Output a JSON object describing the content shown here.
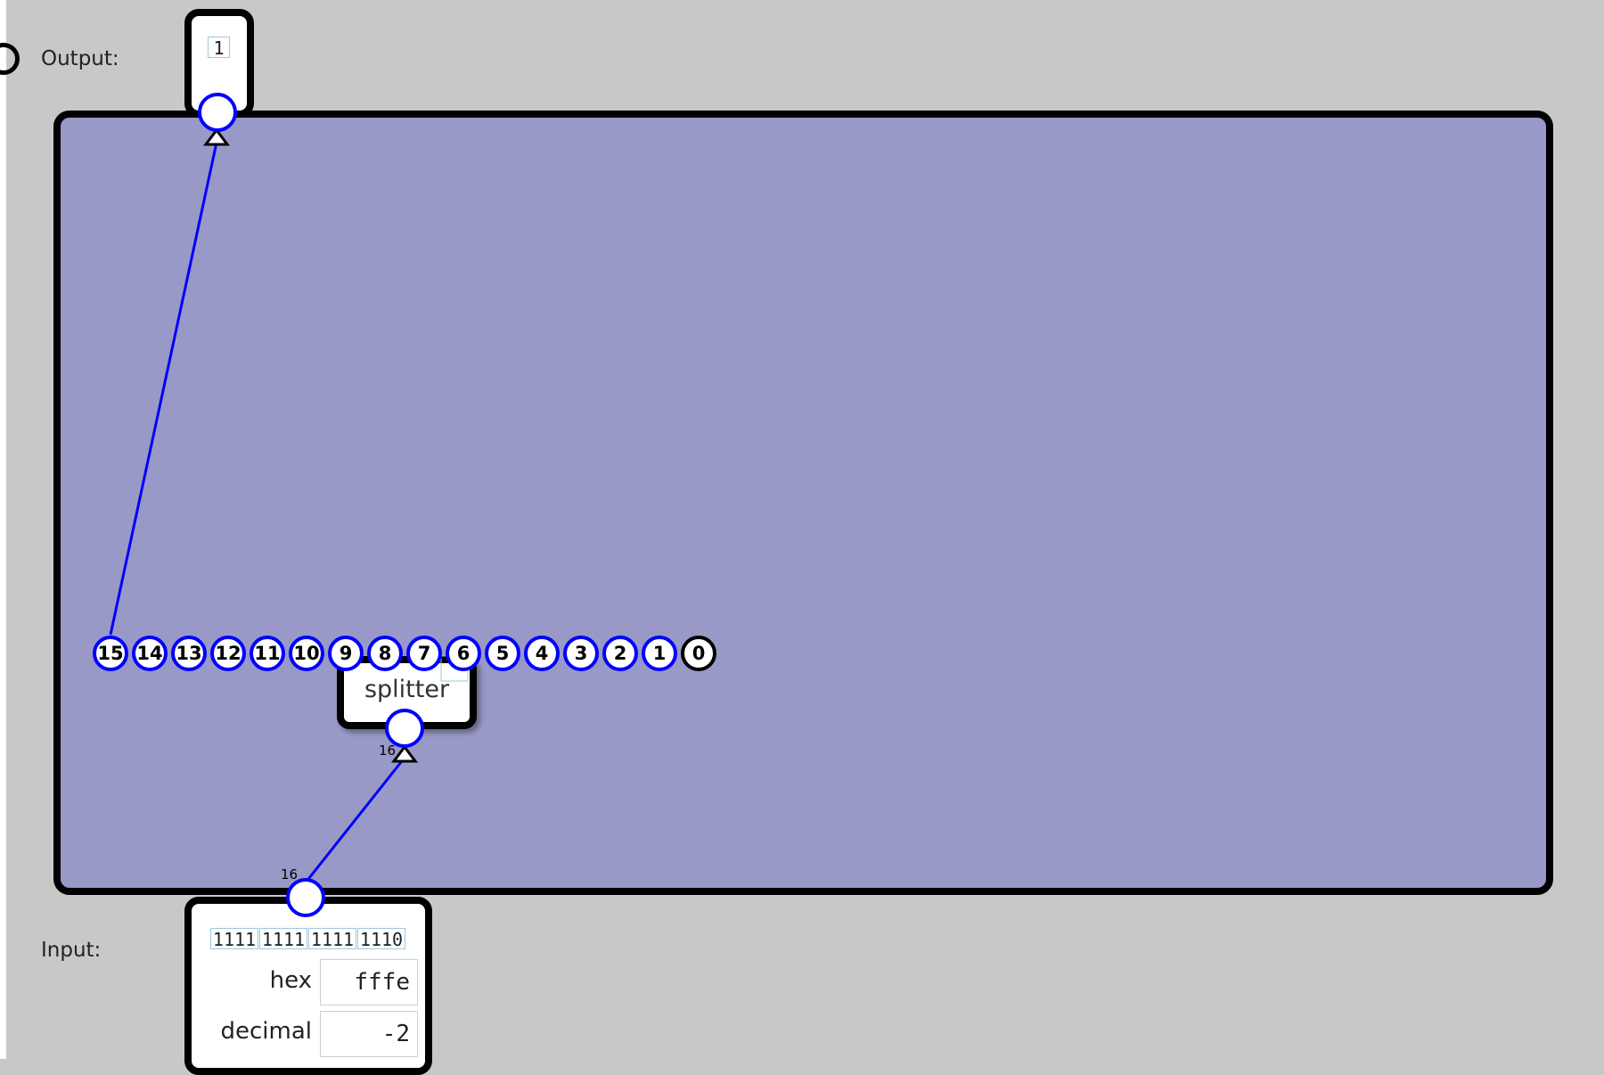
{
  "output": {
    "label": "Output:",
    "value": "1"
  },
  "input": {
    "label": "Input:",
    "nibbles": [
      "1111",
      "1111",
      "1111",
      "1110"
    ],
    "hex_label": "hex",
    "hex_value": "fffe",
    "decimal_label": "decimal",
    "decimal_value": "-2"
  },
  "splitter": {
    "label": "splitter",
    "bits": [
      "15",
      "14",
      "13",
      "12",
      "11",
      "10",
      "9",
      "8",
      "7",
      "6",
      "5",
      "4",
      "3",
      "2",
      "1",
      "0"
    ]
  },
  "wires": {
    "input_width": "16",
    "splitter_width": "16"
  },
  "colors": {
    "wire": "#0000ff",
    "board": "#9999c8",
    "background": "#c8c8c8"
  }
}
